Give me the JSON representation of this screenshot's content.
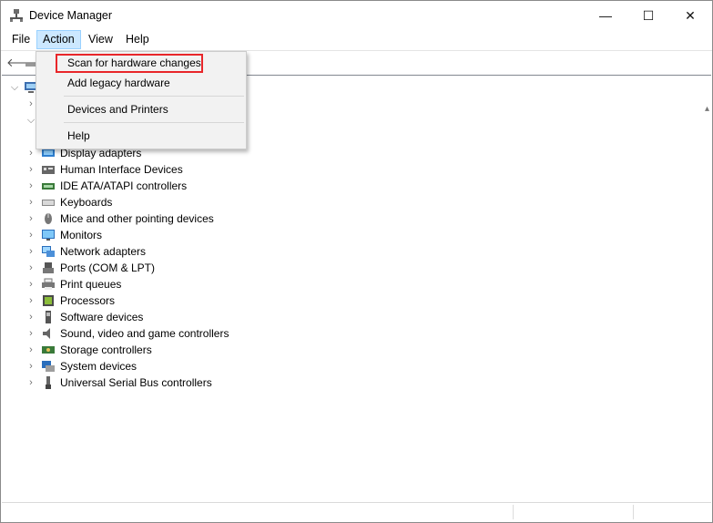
{
  "window": {
    "title": "Device Manager"
  },
  "titlebar": {
    "minimize": "—",
    "maximize": "☐",
    "close": "✕"
  },
  "menubar": {
    "items": [
      "File",
      "Action",
      "View",
      "Help"
    ],
    "active": "Action"
  },
  "action_menu": {
    "items": [
      "Scan for hardware changes",
      "Add legacy hardware",
      "Devices and Printers",
      "Help"
    ],
    "highlighted": "Scan for hardware changes"
  },
  "tree": {
    "categories": [
      {
        "label": "Display adapters",
        "icon": "display-adapter-icon"
      },
      {
        "label": "Human Interface Devices",
        "icon": "hid-icon"
      },
      {
        "label": "IDE ATA/ATAPI controllers",
        "icon": "ide-controller-icon"
      },
      {
        "label": "Keyboards",
        "icon": "keyboard-icon"
      },
      {
        "label": "Mice and other pointing devices",
        "icon": "mouse-icon"
      },
      {
        "label": "Monitors",
        "icon": "monitor-icon"
      },
      {
        "label": "Network adapters",
        "icon": "network-adapter-icon"
      },
      {
        "label": "Ports (COM & LPT)",
        "icon": "port-icon"
      },
      {
        "label": "Print queues",
        "icon": "printer-icon"
      },
      {
        "label": "Processors",
        "icon": "processor-icon"
      },
      {
        "label": "Software devices",
        "icon": "software-device-icon"
      },
      {
        "label": "Sound, video and game controllers",
        "icon": "sound-icon"
      },
      {
        "label": "Storage controllers",
        "icon": "storage-controller-icon"
      },
      {
        "label": "System devices",
        "icon": "system-device-icon"
      },
      {
        "label": "Universal Serial Bus controllers",
        "icon": "usb-icon"
      }
    ]
  },
  "colors": {
    "menu_active_bg": "#cce8ff",
    "highlight_border": "#e8262a",
    "dropdown_bg": "#f2f2f2"
  }
}
